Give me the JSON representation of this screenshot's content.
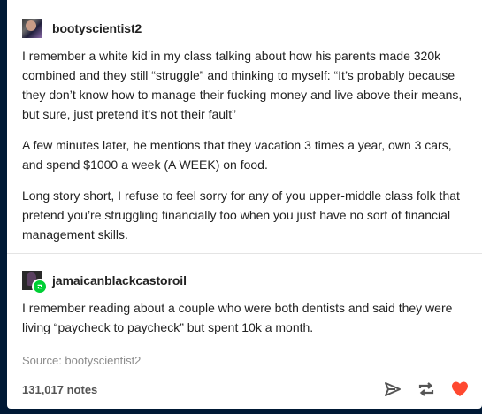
{
  "post1": {
    "username": "bootyscientist2",
    "paragraphs": [
      "I remember a white kid in my class talking about how his parents made 320k combined and they still “struggle” and thinking to myself: “It’s probably because they don’t know how to manage their fucking money and live above their means, but sure, just pretend it’s not their fault”",
      "A few minutes later, he mentions that they vacation 3 times a year, own 3 cars, and spend $1000 a week (A WEEK) on food.",
      "Long story short, I refuse to feel sorry for any of you upper-middle class folk that pretend you’re struggling financially too when you just have no sort of financial management skills."
    ]
  },
  "post2": {
    "username": "jamaicanblackcastoroil",
    "paragraphs": [
      "I remember reading about a couple who were both dentists and said they were living “paycheck to paycheck” but spent 10k a month."
    ]
  },
  "source": "Source: bootyscientist2",
  "notes": "131,017 notes",
  "icons": {
    "share": "paper-plane-icon",
    "reblog": "reblog-icon",
    "like": "heart-icon"
  },
  "colors": {
    "like": "#ff4930",
    "reblog_badge": "#00cf35",
    "icon": "#555555"
  }
}
